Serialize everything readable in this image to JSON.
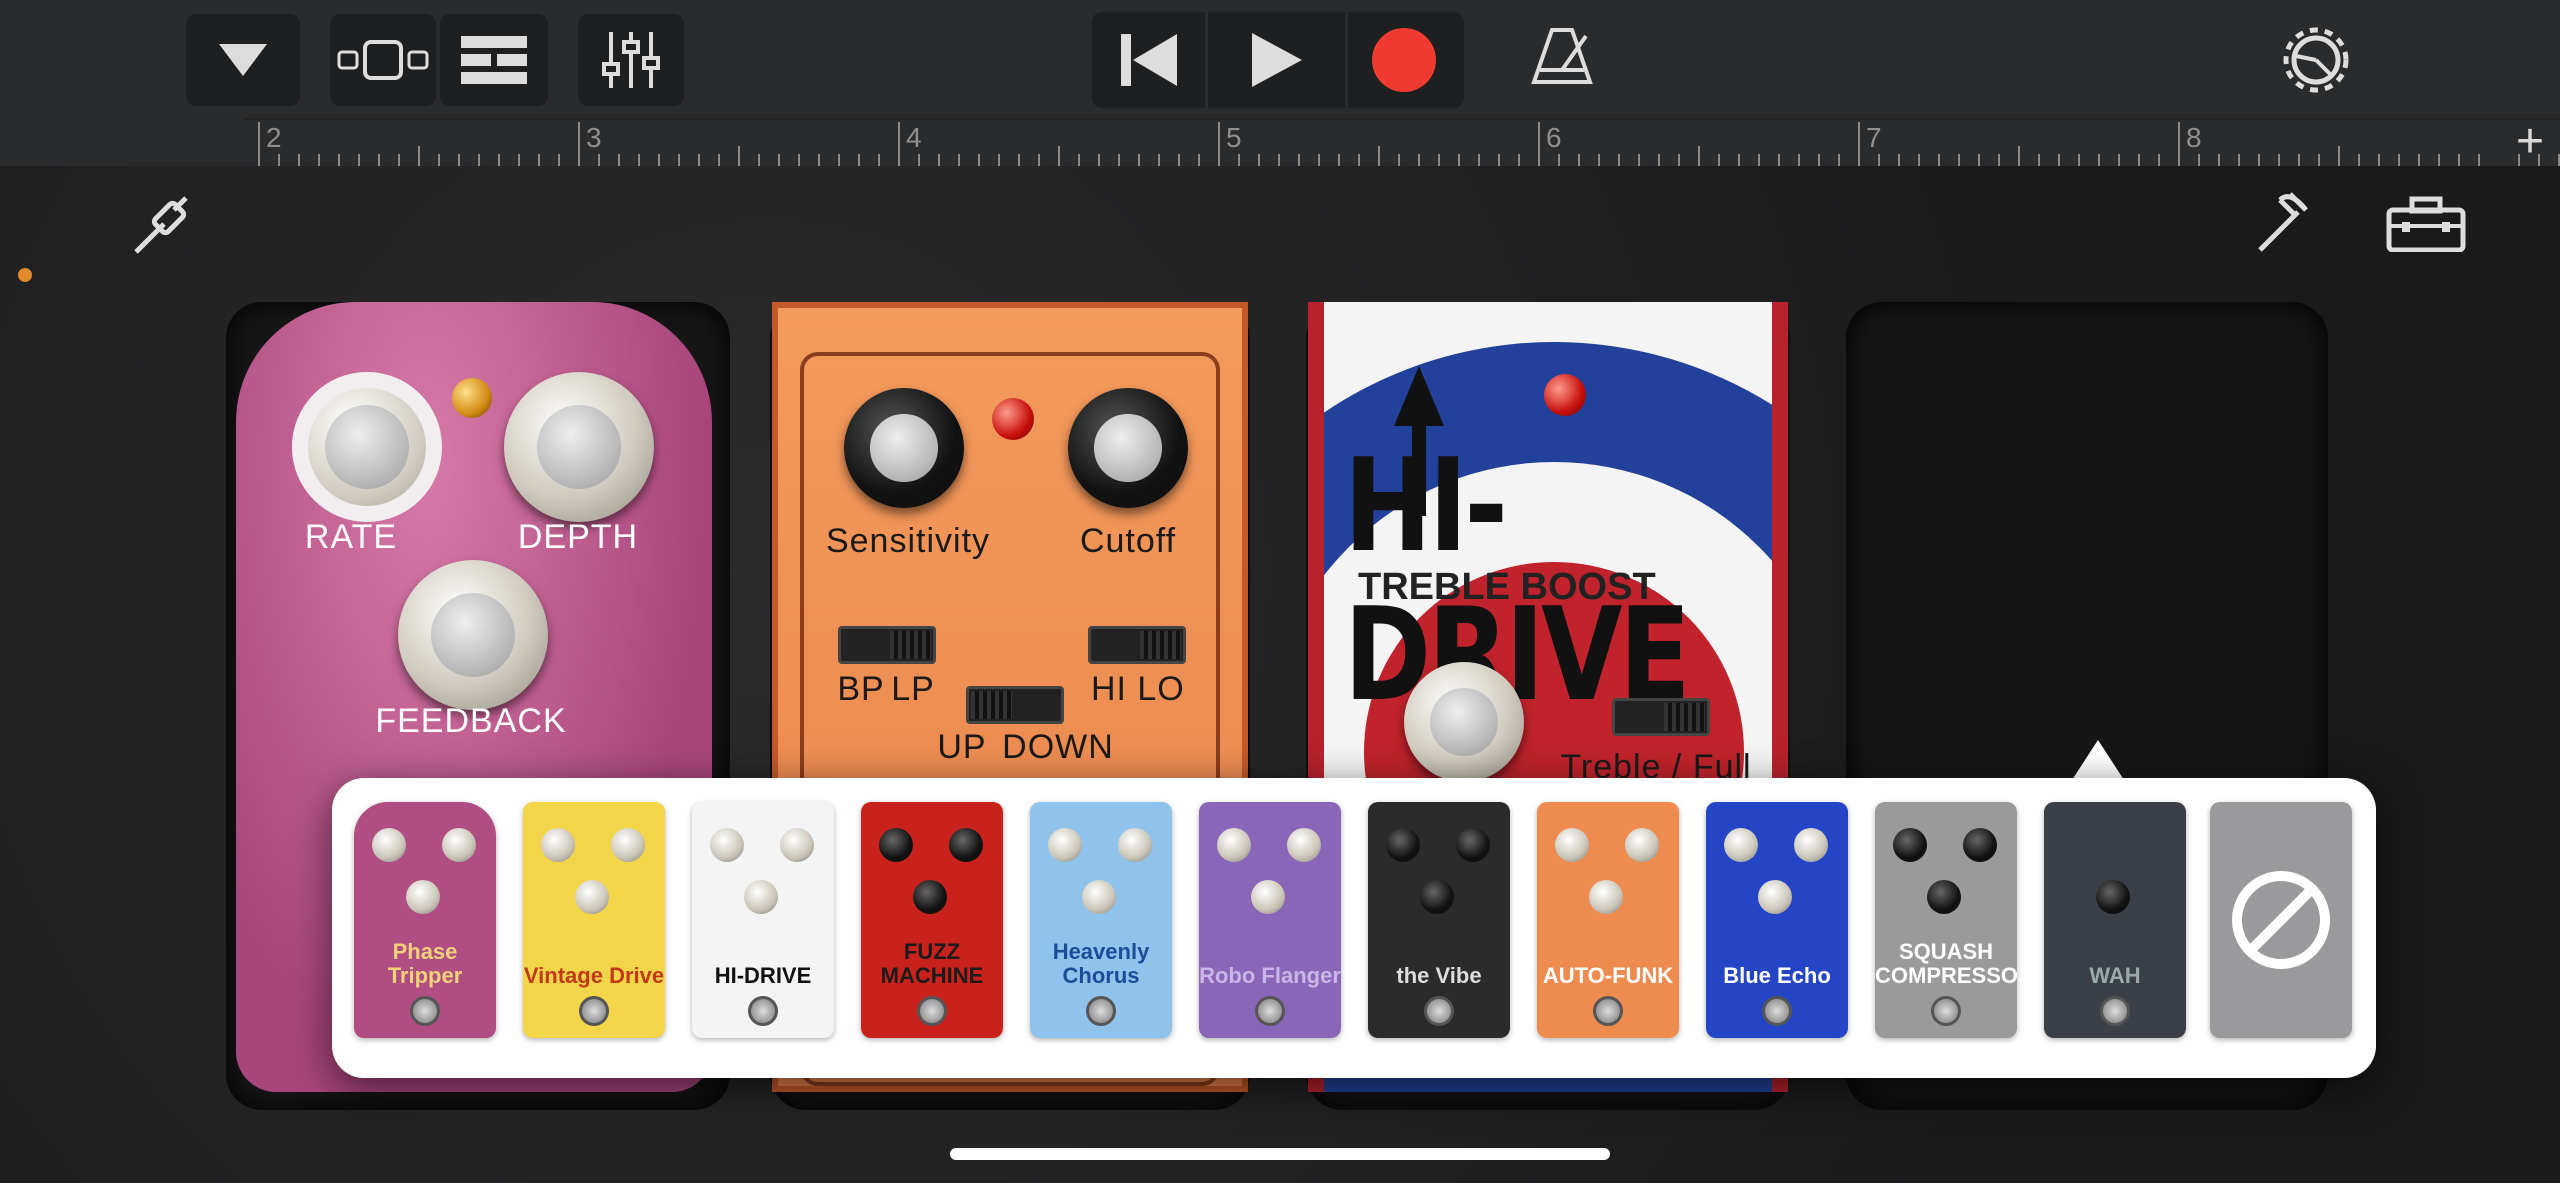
{
  "toolbar": {
    "icons": [
      "dropdown-triangle-icon",
      "browser-view-icon",
      "tracks-view-icon",
      "mixer-icon",
      "rewind-icon",
      "play-icon",
      "record-icon",
      "metronome-icon",
      "settings-gear-icon"
    ]
  },
  "ruler": {
    "markers": [
      "2",
      "3",
      "4",
      "5",
      "6",
      "7",
      "8"
    ],
    "add_label": "+"
  },
  "pedalboard": {
    "phase_tripper": {
      "rate_label": "RATE",
      "depth_label": "DEPTH",
      "feedback_label": "FEEDBACK"
    },
    "auto_funk": {
      "sensitivity_label": "Sensitivity",
      "cutoff_label": "Cutoff",
      "bp_label": "BP",
      "lp_label": "LP",
      "hi_label": "HI",
      "lo_label": "LO",
      "up_label": "UP",
      "down_label": "DOWN"
    },
    "hi_drive": {
      "title": "HI-DRIVE",
      "subtitle": "TREBLE BOOST",
      "switch_label": "Treble / Full"
    }
  },
  "picker": {
    "items": [
      {
        "name": "Phase Tripper",
        "bg": "#b04d82",
        "text": "#f0d27a"
      },
      {
        "name": "Vintage Drive",
        "bg": "#f2d548",
        "text": "#c03a1a"
      },
      {
        "name": "HI-DRIVE",
        "bg": "#f4f4f4",
        "text": "#111"
      },
      {
        "name": "FUZZ MACHINE",
        "bg": "#c9221c",
        "text": "#1b1b1b"
      },
      {
        "name": "Heavenly Chorus",
        "bg": "#8fc3ec",
        "text": "#1e4c9a"
      },
      {
        "name": "Robo Flanger",
        "bg": "#8a66b8",
        "text": "#c8b6e6"
      },
      {
        "name": "the Vibe",
        "bg": "#2b2b2b",
        "text": "#ddd"
      },
      {
        "name": "AUTO-FUNK",
        "bg": "#ee8c4f",
        "text": "#fff"
      },
      {
        "name": "Blue Echo",
        "bg": "#2446c6",
        "text": "#fff"
      },
      {
        "name": "SQUASH COMPRESSOR",
        "bg": "#9a9a9a",
        "text": "#fff"
      },
      {
        "name": "WAH",
        "bg": "#3b3f48",
        "text": "#9aa"
      }
    ],
    "none_icon": "prohibited-icon"
  }
}
